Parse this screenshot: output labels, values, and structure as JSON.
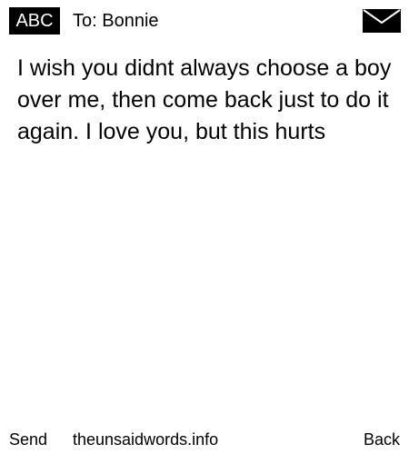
{
  "header": {
    "mode_badge": "ABC",
    "recipient": "To: Bonnie",
    "envelope_icon": "envelope-icon"
  },
  "message": {
    "body": "I wish you didnt always choose a boy over me, then come back just to do it again. I love you, but this hurts"
  },
  "footer": {
    "left_softkey": "Send",
    "site": "theunsaidwords.info",
    "right_softkey": "Back"
  },
  "colors": {
    "background": "#ffffff",
    "text": "#000000",
    "badge_background": "#000000",
    "badge_text": "#ffffff"
  }
}
